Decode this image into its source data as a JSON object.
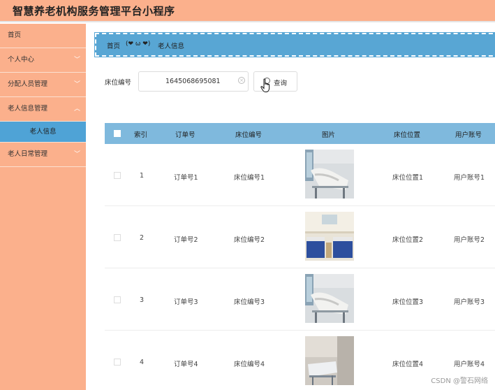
{
  "app": {
    "title": "智慧养老机构服务管理平台小程序"
  },
  "sidebar": {
    "items": [
      {
        "label": "首页"
      },
      {
        "label": "个人中心"
      },
      {
        "label": "分配人员管理"
      },
      {
        "label": "老人信息管理"
      },
      {
        "label": "老人日常管理"
      }
    ],
    "sub_item": "老人信息"
  },
  "breadcrumb": {
    "home": "首页",
    "separator": "(❤ ω ❤)",
    "current": "老人信息"
  },
  "search": {
    "label": "床位编号",
    "value": "1645068695081",
    "button": "查询"
  },
  "table": {
    "columns": [
      "索引",
      "订单号",
      "床位编号",
      "图片",
      "床位位置",
      "用户账号"
    ],
    "rows": [
      {
        "index": "1",
        "order": "订单号1",
        "bed_no": "床位编号1",
        "location": "床位位置1",
        "account": "用户账号1",
        "photo": "bed-photo-1"
      },
      {
        "index": "2",
        "order": "订单号2",
        "bed_no": "床位编号2",
        "location": "床位位置2",
        "account": "用户账号2",
        "photo": "ward-photo-2"
      },
      {
        "index": "3",
        "order": "订单号3",
        "bed_no": "床位编号3",
        "location": "床位位置3",
        "account": "用户账号3",
        "photo": "bed-photo-3"
      },
      {
        "index": "4",
        "order": "订单号4",
        "bed_no": "床位编号4",
        "location": "床位位置4",
        "account": "用户账号4",
        "photo": "room-photo-4"
      }
    ]
  },
  "watermark": "CSDN @警石网络",
  "colors": {
    "topbar": "#fbb08c",
    "sidebar": "#fbb08c",
    "active_sub": "#4fa3d6",
    "breadcrumb": "#58a6d4",
    "table_head": "#7fb9dd"
  }
}
